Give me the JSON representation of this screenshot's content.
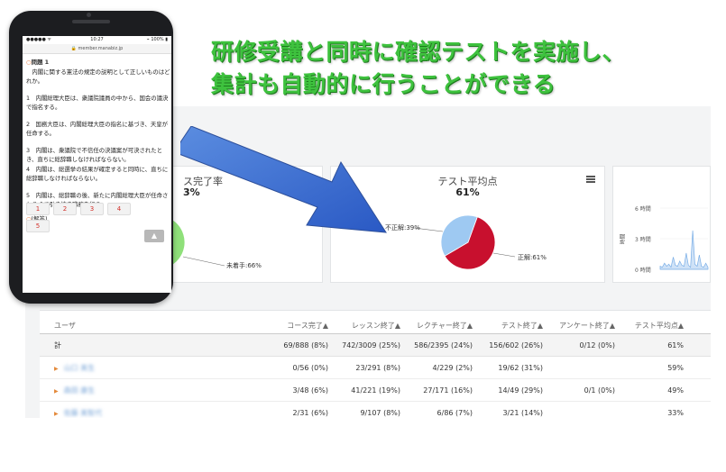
{
  "headline": {
    "line1": "研修受講と同時に確認テストを実施し、",
    "line2": "集計も自動的に行うことができる"
  },
  "phone": {
    "status": {
      "carrier": "●●●●● ᯤ",
      "time": "10:27",
      "battery": "⌁ 100% ▮"
    },
    "url": "🔒 member.manabiz.jp",
    "question_label": "問題 1",
    "question": "　内閣に関する憲法の規定の説明として正しいものはどれか。",
    "options": [
      "1　内閣総理大臣は、衆議院議員の中から、国会の議決で指名する。",
      "2　国務大臣は、内閣総理大臣の指名に基づき、天皇が任命する。",
      "3　内閣は、衆議院で不信任の決議案が可決されたとき、直ちに総辞職しなければならない。",
      "4　内閣は、総選挙の結果が確定すると同時に、直ちに総辞職しなければならない。",
      "5　内閣は、総辞職の後、新たに内閣総理大臣が任命されるまで引き続き職務を行う。"
    ],
    "answer_label": "[解答]",
    "choices": [
      "1",
      "2",
      "3",
      "4",
      "5"
    ],
    "scroll_top_label": "▲"
  },
  "dashboard": {
    "completion_card": {
      "title": "ス完了率",
      "value": "3%",
      "legend_label": "未着手:66%"
    },
    "test_card": {
      "title": "テスト平均点",
      "value": "61%",
      "label_incorrect": "不正解:39%",
      "label_correct": "正解:61%"
    },
    "time_card": {
      "ticks": [
        "6 時間",
        "3 時間",
        "0 時間"
      ],
      "axis": "時間"
    },
    "table": {
      "headers": [
        "ユーザ",
        "コース完了▲",
        "レッスン終了▲",
        "レクチャー終了▲",
        "テスト終了▲",
        "アンケート終了▲",
        "テスト平均点▲"
      ],
      "total_row": [
        "計",
        "69/888 (8%)",
        "742/3009 (25%)",
        "586/2395 (24%)",
        "156/602 (26%)",
        "0/12 (0%)",
        "61%"
      ],
      "rows": [
        [
          "▶",
          "山口 美生",
          "0/56 (0%)",
          "23/291 (8%)",
          "4/229 (2%)",
          "19/62 (31%)",
          "",
          "59%"
        ],
        [
          "▶",
          "森田 康生",
          "3/48 (6%)",
          "41/221 (19%)",
          "27/171 (16%)",
          "14/49 (29%)",
          "0/1 (0%)",
          "49%"
        ],
        [
          "▶",
          "佐藤 美智代",
          "2/31 (6%)",
          "9/107 (8%)",
          "6/86 (7%)",
          "3/21 (14%)",
          "",
          "33%"
        ]
      ]
    }
  },
  "chart_data": [
    {
      "type": "pie",
      "title": "テスト平均点",
      "categories": [
        "正解",
        "不正解"
      ],
      "values": [
        61,
        39
      ],
      "colors": [
        "#c8102e",
        "#9ec9f2"
      ]
    },
    {
      "type": "pie",
      "title": "",
      "categories": [
        "未着手"
      ],
      "values": [
        66
      ],
      "colors": [
        "#8fe07a"
      ]
    },
    {
      "type": "line",
      "title": "",
      "ylabel": "時間",
      "yticks": [
        "0 時間",
        "3 時間",
        "6 時間"
      ],
      "ylim": [
        0,
        6
      ],
      "values": [
        0.3,
        0.2,
        0.6,
        0.3,
        0.5,
        0.2,
        1.2,
        0.4,
        0.3,
        0.8,
        0.4,
        0.3,
        1.6,
        0.4,
        0.2,
        3.8,
        0.5,
        0.3,
        1.4,
        0.3,
        0.2,
        0.6,
        0.2
      ],
      "color": "#7aaee6"
    }
  ]
}
